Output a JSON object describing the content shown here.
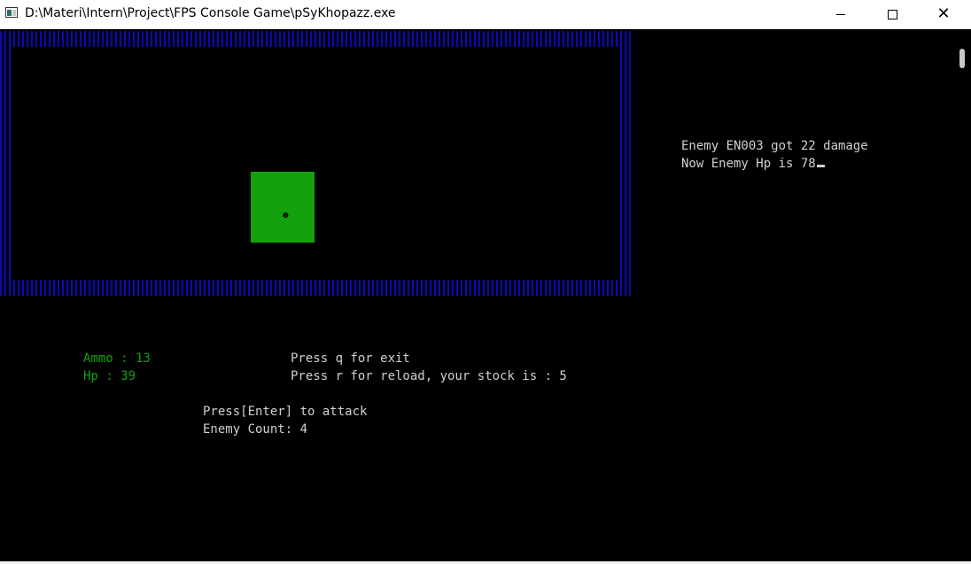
{
  "window": {
    "title": "D:\\Materi\\Intern\\Project\\FPS Console Game\\pSyKhopazz.exe",
    "icon": "console-app-icon",
    "controls": {
      "minimize": "minimize-icon",
      "maximize": "maximize-icon",
      "close": "close-icon"
    },
    "close_glyph": "✕"
  },
  "game": {
    "enemy_glyph": "☻",
    "enemy_color": "#13a10e",
    "wall_color": "#0b0bb8"
  },
  "log": {
    "line1": "Enemy EN003 got 22 damage",
    "line2": "Now Enemy Hp is 78"
  },
  "stats": {
    "ammo": "Ammo : 13",
    "hp": "Hp : 39"
  },
  "help": {
    "exit": "Press q for exit",
    "reload": "Press r for reload, your stock is : 5",
    "attack": "Press[Enter] to attack",
    "enemy_count": "Enemy Count: 4"
  }
}
